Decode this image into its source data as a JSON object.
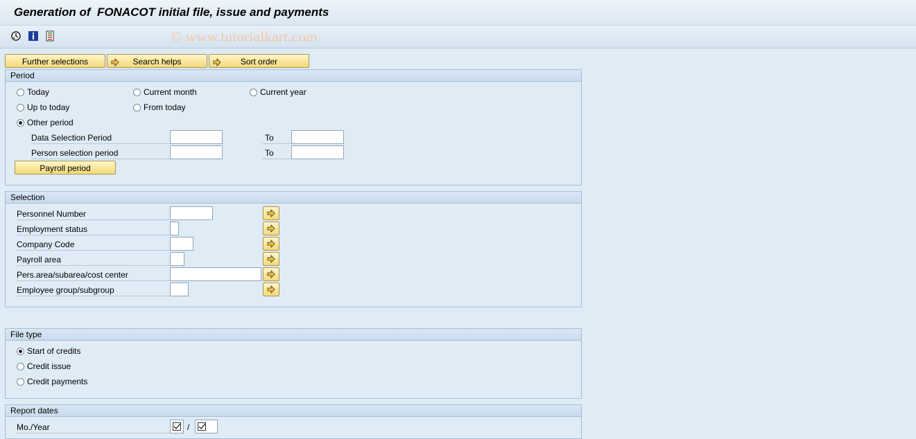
{
  "window": {
    "title": "Generation of  FONACOT initial file, issue and payments"
  },
  "toolbar": {
    "icons": [
      "execute-clock-icon",
      "info-icon",
      "selection-list-icon"
    ],
    "watermark": "© www.tutorialkart.com"
  },
  "top_buttons": {
    "further_selections": "Further selections",
    "search_helps": "Search helps",
    "sort_order": "Sort order"
  },
  "period": {
    "header": "Period",
    "today": "Today",
    "current_month": "Current month",
    "current_year": "Current year",
    "up_to_today": "Up to today",
    "from_today": "From today",
    "other_period": "Other period",
    "selected": "other_period",
    "data_selection_label": "Data Selection Period",
    "person_selection_label": "Person selection period",
    "to_label": "To",
    "data_from": "",
    "data_to": "",
    "person_from": "",
    "person_to": "",
    "payroll_button": "Payroll period"
  },
  "selection": {
    "header": "Selection",
    "personnel_number": "Personnel Number",
    "employment_status": "Employment status",
    "company_code": "Company Code",
    "payroll_area": "Payroll area",
    "pers_area": "Pers.area/subarea/cost center",
    "employee_group": "Employee group/subgroup"
  },
  "file_type": {
    "header": "File type",
    "start_of_credits": "Start of credits",
    "credit_issue": "Credit issue",
    "credit_payments": "Credit payments",
    "selected": "start_of_credits"
  },
  "report_dates": {
    "header": "Report dates",
    "mo_year": "Mo./Year",
    "separator": "/"
  },
  "colors": {
    "background": "#dfebf5",
    "button_yellow": "#f4d978",
    "frame_border": "#a8bfd6"
  }
}
